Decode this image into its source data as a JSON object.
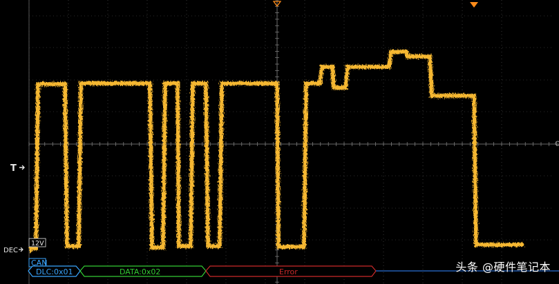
{
  "trigger_label": "T",
  "channel": {
    "name": "DEC",
    "voltage_badge": "12V"
  },
  "bus_label": "CAN",
  "bus_segments": [
    {
      "text": "DLC:0x01",
      "color": "#3aa6ff"
    },
    {
      "text": "DATA:0x02",
      "color": "#33cc33"
    },
    {
      "text": "Error",
      "color": "#cc2a2a"
    }
  ],
  "watermark": "头条 @硬件笔记本",
  "colors": {
    "trace": "#f5b731",
    "grid": "#5a5a5a",
    "marker": "#ff8c1a",
    "bus_idle": "#2a6fd6"
  }
}
